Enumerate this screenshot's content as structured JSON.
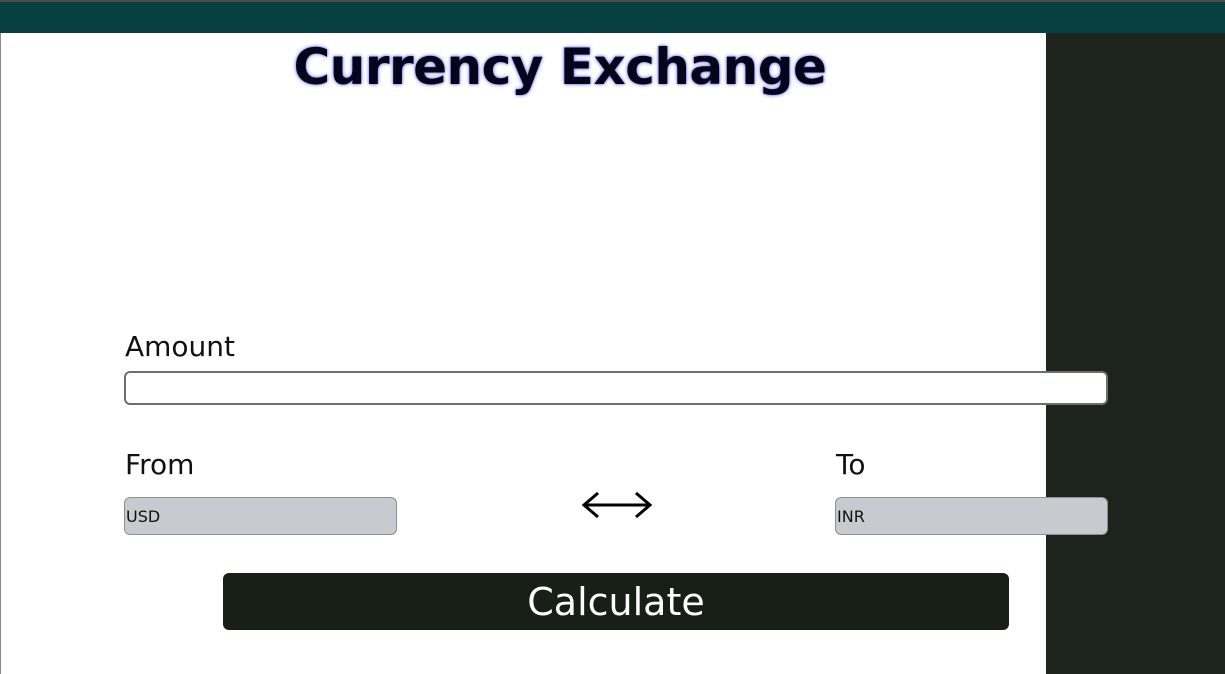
{
  "header": {
    "title": "Currency Exchange"
  },
  "form": {
    "amount_label": "Amount",
    "amount_value": "",
    "from_label": "From",
    "from_value": "USD",
    "to_label": "To",
    "to_value": "INR",
    "swap_icon": "left-right-arrow-icon",
    "calculate_label": "Calculate"
  },
  "colors": {
    "topbar": "#064040",
    "right_panel": "#1d231d",
    "button": "#171f16",
    "select_bg": "#c9cacf"
  }
}
